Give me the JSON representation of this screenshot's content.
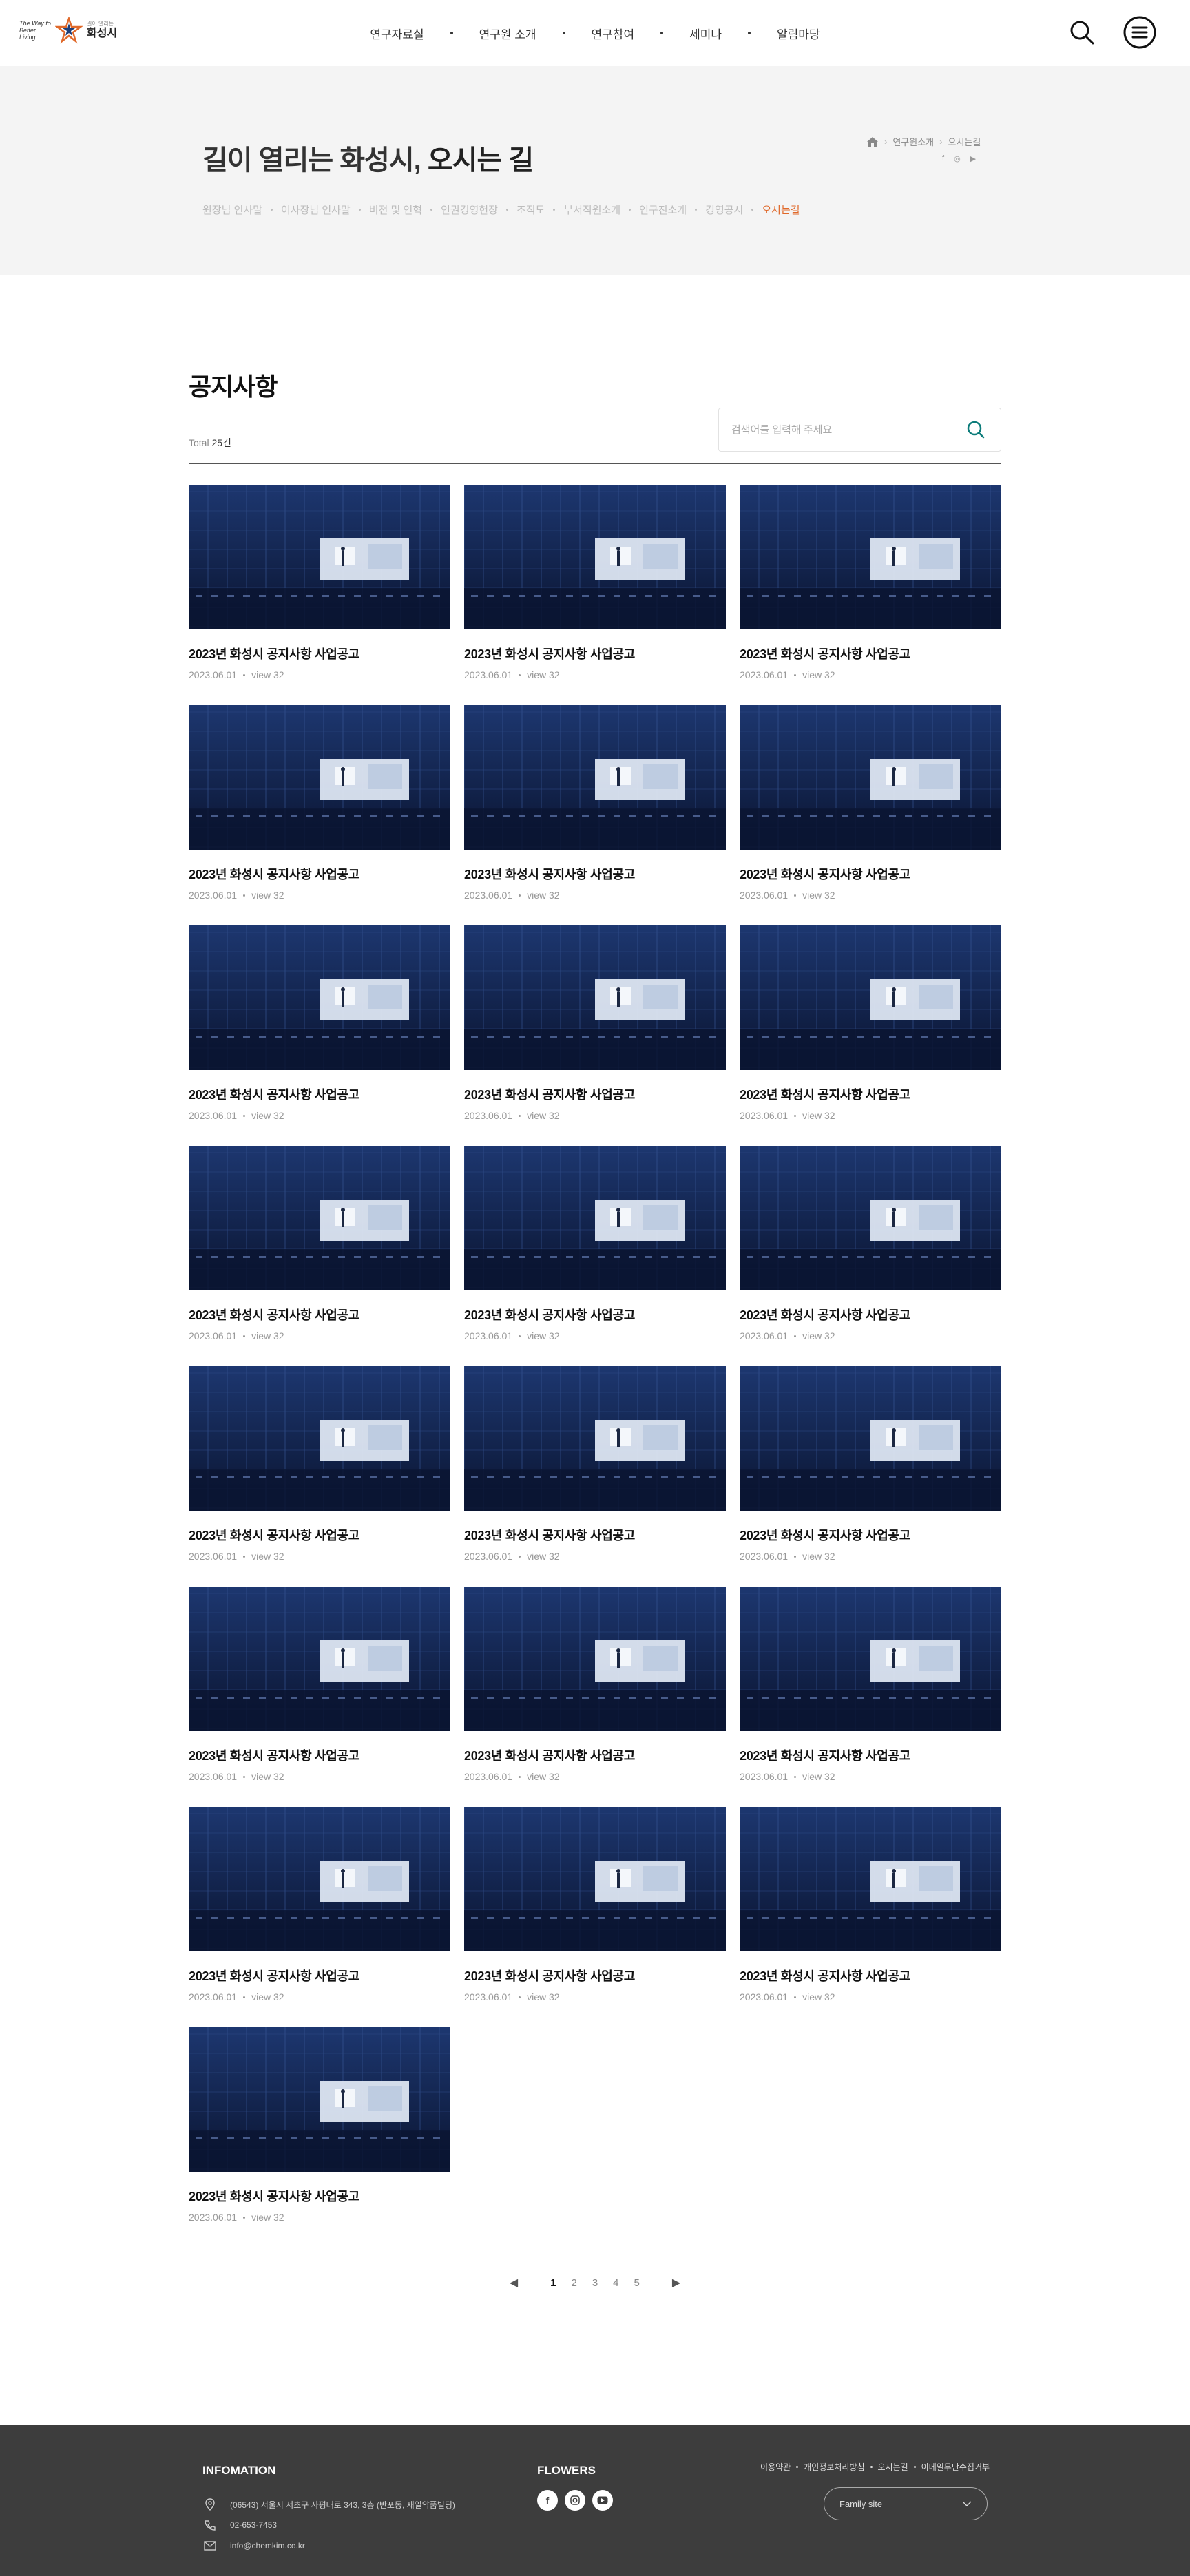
{
  "brand": {
    "tagline": "The Way to Better Living",
    "sub": "길이 열리는",
    "name": "화성시",
    "accent": "#e0692a"
  },
  "gnb": [
    "연구자료실",
    "연구원 소개",
    "연구참여",
    "세미나",
    "알림마당"
  ],
  "header_icons": [
    "search-icon",
    "menu-icon"
  ],
  "subvisual": {
    "title_light": "길이 열리는 화성시,",
    "title_bold": "오시는 길",
    "breadcrumb": [
      "연구원소개",
      "오시는길"
    ],
    "tabs": [
      "원장님 인사말",
      "이사장님 인사말",
      "비전 및 연혁",
      "인권경영헌장",
      "조직도",
      "부서직원소개",
      "연구진소개",
      "경영공시",
      "오시는길"
    ],
    "active_tab": 8
  },
  "board": {
    "title": "공지사항",
    "total_label": "Total",
    "total_count": "25건",
    "search_placeholder": "검색어를 입력해 주세요"
  },
  "posts": [
    {
      "title": "2023년 화성시 공지사항 사업공고",
      "date": "2023.06.01",
      "views": "view 32"
    },
    {
      "title": "2023년 화성시 공지사항 사업공고",
      "date": "2023.06.01",
      "views": "view 32"
    },
    {
      "title": "2023년 화성시 공지사항 사업공고",
      "date": "2023.06.01",
      "views": "view 32"
    },
    {
      "title": "2023년 화성시 공지사항 사업공고",
      "date": "2023.06.01",
      "views": "view 32"
    },
    {
      "title": "2023년 화성시 공지사항 사업공고",
      "date": "2023.06.01",
      "views": "view 32"
    },
    {
      "title": "2023년 화성시 공지사항 사업공고",
      "date": "2023.06.01",
      "views": "view 32"
    },
    {
      "title": "2023년 화성시 공지사항 사업공고",
      "date": "2023.06.01",
      "views": "view 32"
    },
    {
      "title": "2023년 화성시 공지사항 사업공고",
      "date": "2023.06.01",
      "views": "view 32"
    },
    {
      "title": "2023년 화성시 공지사항 사업공고",
      "date": "2023.06.01",
      "views": "view 32"
    },
    {
      "title": "2023년 화성시 공지사항 사업공고",
      "date": "2023.06.01",
      "views": "view 32"
    },
    {
      "title": "2023년 화성시 공지사항 사업공고",
      "date": "2023.06.01",
      "views": "view 32"
    },
    {
      "title": "2023년 화성시 공지사항 사업공고",
      "date": "2023.06.01",
      "views": "view 32"
    },
    {
      "title": "2023년 화성시 공지사항 사업공고",
      "date": "2023.06.01",
      "views": "view 32"
    },
    {
      "title": "2023년 화성시 공지사항 사업공고",
      "date": "2023.06.01",
      "views": "view 32"
    },
    {
      "title": "2023년 화성시 공지사항 사업공고",
      "date": "2023.06.01",
      "views": "view 32"
    },
    {
      "title": "2023년 화성시 공지사항 사업공고",
      "date": "2023.06.01",
      "views": "view 32"
    },
    {
      "title": "2023년 화성시 공지사항 사업공고",
      "date": "2023.06.01",
      "views": "view 32"
    },
    {
      "title": "2023년 화성시 공지사항 사업공고",
      "date": "2023.06.01",
      "views": "view 32"
    },
    {
      "title": "2023년 화성시 공지사항 사업공고",
      "date": "2023.06.01",
      "views": "view 32"
    },
    {
      "title": "2023년 화성시 공지사항 사업공고",
      "date": "2023.06.01",
      "views": "view 32"
    },
    {
      "title": "2023년 화성시 공지사항 사업공고",
      "date": "2023.06.01",
      "views": "view 32"
    },
    {
      "title": "2023년 화성시 공지사항 사업공고",
      "date": "2023.06.01",
      "views": "view 32"
    }
  ],
  "pagination": {
    "prev": "◀",
    "next": "▶",
    "pages": [
      "1",
      "2",
      "3",
      "4",
      "5"
    ],
    "current": "1"
  },
  "footer": {
    "info_title": "INFOMATION",
    "address": "(06543) 서울시 서초구 사평대로 343, 3층 (반포동, 재일약품빌딩)",
    "phone": "02-653-7453",
    "email": "info@chemkim.co.kr",
    "flowers_title": "FLOWERS",
    "links": [
      "이용약관",
      "개인정보처리방침",
      "오시는길",
      "이메일무단수집거부"
    ],
    "family_site": "Family site"
  }
}
